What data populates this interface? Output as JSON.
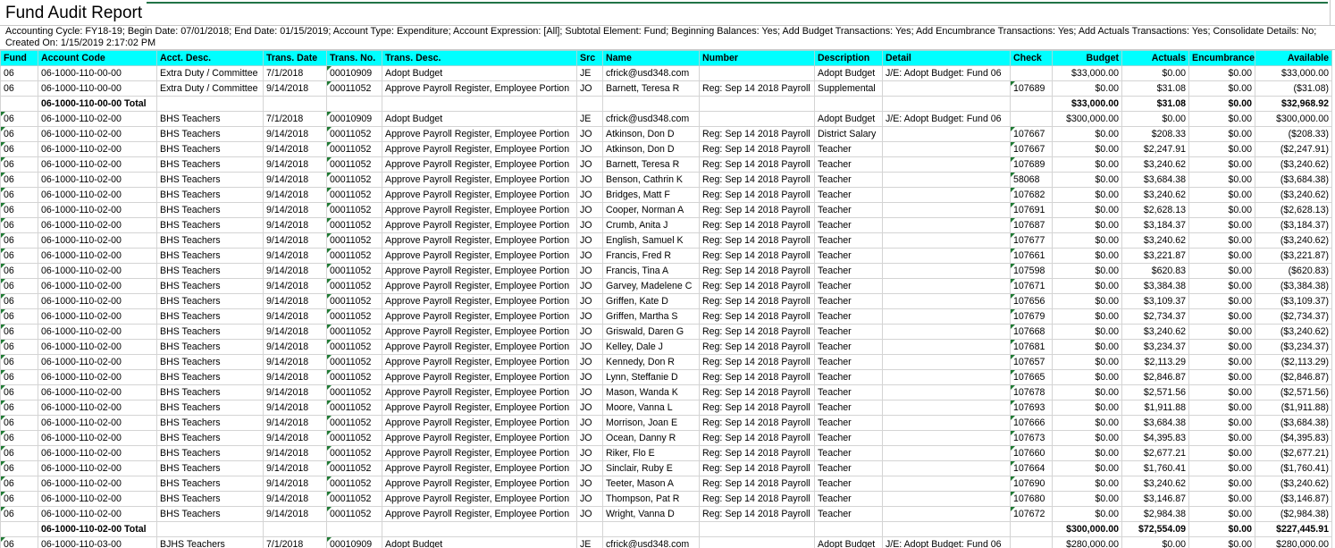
{
  "report": {
    "title": "Fund Audit Report",
    "params_line1": "Accounting Cycle: FY18-19; Begin Date: 07/01/2018; End Date: 01/15/2019; Account Type: Expenditure; Account Expression: [All]; Subtotal Element: Fund; Beginning Balances: Yes; Add Budget Transactions: Yes; Add Encumbrance Transactions: Yes; Add Actuals Transactions: Yes; Consolidate Details: No;",
    "params_line2": "Created On: 1/15/2019 2:17:02 PM"
  },
  "columns": [
    {
      "label": "Fund",
      "align": "left"
    },
    {
      "label": "Account Code",
      "align": "left"
    },
    {
      "label": "Acct. Desc.",
      "align": "left"
    },
    {
      "label": "Trans. Date",
      "align": "left"
    },
    {
      "label": "Trans. No.",
      "align": "left"
    },
    {
      "label": "Trans. Desc.",
      "align": "left"
    },
    {
      "label": "Src",
      "align": "left"
    },
    {
      "label": "Name",
      "align": "left"
    },
    {
      "label": "Number",
      "align": "left"
    },
    {
      "label": "Description",
      "align": "left"
    },
    {
      "label": "Detail",
      "align": "left"
    },
    {
      "label": "Check",
      "align": "left"
    },
    {
      "label": "Budget",
      "align": "right"
    },
    {
      "label": "Actuals",
      "align": "right"
    },
    {
      "label": "Encumbrance",
      "align": "right"
    },
    {
      "label": "Available",
      "align": "right"
    }
  ],
  "rows": [
    {
      "type": "data",
      "fund_flag": false,
      "no_flag": true,
      "check_flag": false,
      "cells": [
        "06",
        "06-1000-110-00-00",
        "Extra Duty / Committee",
        "7/1/2018",
        "00010909",
        "Adopt Budget",
        "JE",
        "cfrick@usd348.com",
        "",
        "Adopt Budget",
        "J/E: Adopt Budget: Fund 06",
        "",
        "$33,000.00",
        "$0.00",
        "$0.00",
        "$33,000.00"
      ]
    },
    {
      "type": "data",
      "fund_flag": false,
      "no_flag": true,
      "check_flag": true,
      "cells": [
        "06",
        "06-1000-110-00-00",
        "Extra Duty / Committee",
        "9/14/2018",
        "00011052",
        "Approve Payroll Register, Employee Portion",
        "JO",
        "Barnett, Teresa R",
        "Reg: Sep 14 2018 Payroll",
        "Supplemental",
        "",
        "107689",
        "$0.00",
        "$31.08",
        "$0.00",
        "($31.08)"
      ]
    },
    {
      "type": "total",
      "cells": [
        "",
        "06-1000-110-00-00 Total",
        "",
        "",
        "",
        "",
        "",
        "",
        "",
        "",
        "",
        "",
        "$33,000.00",
        "$31.08",
        "$0.00",
        "$32,968.92"
      ]
    },
    {
      "type": "data",
      "fund_flag": true,
      "no_flag": true,
      "check_flag": false,
      "cells": [
        "06",
        "06-1000-110-02-00",
        "BHS Teachers",
        "7/1/2018",
        "00010909",
        "Adopt Budget",
        "JE",
        "cfrick@usd348.com",
        "",
        "Adopt Budget",
        "J/E: Adopt Budget: Fund 06",
        "",
        "$300,000.00",
        "$0.00",
        "$0.00",
        "$300,000.00"
      ]
    },
    {
      "type": "data",
      "fund_flag": true,
      "no_flag": true,
      "check_flag": true,
      "cells": [
        "06",
        "06-1000-110-02-00",
        "BHS Teachers",
        "9/14/2018",
        "00011052",
        "Approve Payroll Register, Employee Portion",
        "JO",
        "Atkinson, Don D",
        "Reg: Sep 14 2018 Payroll",
        "District Salary",
        "",
        "107667",
        "$0.00",
        "$208.33",
        "$0.00",
        "($208.33)"
      ]
    },
    {
      "type": "data",
      "fund_flag": true,
      "no_flag": true,
      "check_flag": true,
      "cells": [
        "06",
        "06-1000-110-02-00",
        "BHS Teachers",
        "9/14/2018",
        "00011052",
        "Approve Payroll Register, Employee Portion",
        "JO",
        "Atkinson, Don D",
        "Reg: Sep 14 2018 Payroll",
        "Teacher",
        "",
        "107667",
        "$0.00",
        "$2,247.91",
        "$0.00",
        "($2,247.91)"
      ]
    },
    {
      "type": "data",
      "fund_flag": true,
      "no_flag": true,
      "check_flag": true,
      "cells": [
        "06",
        "06-1000-110-02-00",
        "BHS Teachers",
        "9/14/2018",
        "00011052",
        "Approve Payroll Register, Employee Portion",
        "JO",
        "Barnett, Teresa R",
        "Reg: Sep 14 2018 Payroll",
        "Teacher",
        "",
        "107689",
        "$0.00",
        "$3,240.62",
        "$0.00",
        "($3,240.62)"
      ]
    },
    {
      "type": "data",
      "fund_flag": true,
      "no_flag": true,
      "check_flag": true,
      "cells": [
        "06",
        "06-1000-110-02-00",
        "BHS Teachers",
        "9/14/2018",
        "00011052",
        "Approve Payroll Register, Employee Portion",
        "JO",
        "Benson, Cathrin K",
        "Reg: Sep 14 2018 Payroll",
        "Teacher",
        "",
        "58068",
        "$0.00",
        "$3,684.38",
        "$0.00",
        "($3,684.38)"
      ]
    },
    {
      "type": "data",
      "fund_flag": true,
      "no_flag": true,
      "check_flag": true,
      "cells": [
        "06",
        "06-1000-110-02-00",
        "BHS Teachers",
        "9/14/2018",
        "00011052",
        "Approve Payroll Register, Employee Portion",
        "JO",
        "Bridges, Matt F",
        "Reg: Sep 14 2018 Payroll",
        "Teacher",
        "",
        "107682",
        "$0.00",
        "$3,240.62",
        "$0.00",
        "($3,240.62)"
      ]
    },
    {
      "type": "data",
      "fund_flag": true,
      "no_flag": true,
      "check_flag": true,
      "cells": [
        "06",
        "06-1000-110-02-00",
        "BHS Teachers",
        "9/14/2018",
        "00011052",
        "Approve Payroll Register, Employee Portion",
        "JO",
        "Cooper, Norman A",
        "Reg: Sep 14 2018 Payroll",
        "Teacher",
        "",
        "107691",
        "$0.00",
        "$2,628.13",
        "$0.00",
        "($2,628.13)"
      ]
    },
    {
      "type": "data",
      "fund_flag": true,
      "no_flag": true,
      "check_flag": true,
      "cells": [
        "06",
        "06-1000-110-02-00",
        "BHS Teachers",
        "9/14/2018",
        "00011052",
        "Approve Payroll Register, Employee Portion",
        "JO",
        "Crumb, Anita J",
        "Reg: Sep 14 2018 Payroll",
        "Teacher",
        "",
        "107687",
        "$0.00",
        "$3,184.37",
        "$0.00",
        "($3,184.37)"
      ]
    },
    {
      "type": "data",
      "fund_flag": true,
      "no_flag": true,
      "check_flag": true,
      "cells": [
        "06",
        "06-1000-110-02-00",
        "BHS Teachers",
        "9/14/2018",
        "00011052",
        "Approve Payroll Register, Employee Portion",
        "JO",
        "English, Samuel K",
        "Reg: Sep 14 2018 Payroll",
        "Teacher",
        "",
        "107677",
        "$0.00",
        "$3,240.62",
        "$0.00",
        "($3,240.62)"
      ]
    },
    {
      "type": "data",
      "fund_flag": true,
      "no_flag": true,
      "check_flag": true,
      "cells": [
        "06",
        "06-1000-110-02-00",
        "BHS Teachers",
        "9/14/2018",
        "00011052",
        "Approve Payroll Register, Employee Portion",
        "JO",
        "Francis, Fred R",
        "Reg: Sep 14 2018 Payroll",
        "Teacher",
        "",
        "107661",
        "$0.00",
        "$3,221.87",
        "$0.00",
        "($3,221.87)"
      ]
    },
    {
      "type": "data",
      "fund_flag": true,
      "no_flag": true,
      "check_flag": true,
      "cells": [
        "06",
        "06-1000-110-02-00",
        "BHS Teachers",
        "9/14/2018",
        "00011052",
        "Approve Payroll Register, Employee Portion",
        "JO",
        "Francis, Tina A",
        "Reg: Sep 14 2018 Payroll",
        "Teacher",
        "",
        "107598",
        "$0.00",
        "$620.83",
        "$0.00",
        "($620.83)"
      ]
    },
    {
      "type": "data",
      "fund_flag": true,
      "no_flag": true,
      "check_flag": true,
      "cells": [
        "06",
        "06-1000-110-02-00",
        "BHS Teachers",
        "9/14/2018",
        "00011052",
        "Approve Payroll Register, Employee Portion",
        "JO",
        "Garvey, Madelene C",
        "Reg: Sep 14 2018 Payroll",
        "Teacher",
        "",
        "107671",
        "$0.00",
        "$3,384.38",
        "$0.00",
        "($3,384.38)"
      ]
    },
    {
      "type": "data",
      "fund_flag": true,
      "no_flag": true,
      "check_flag": true,
      "cells": [
        "06",
        "06-1000-110-02-00",
        "BHS Teachers",
        "9/14/2018",
        "00011052",
        "Approve Payroll Register, Employee Portion",
        "JO",
        "Griffen, Kate D",
        "Reg: Sep 14 2018 Payroll",
        "Teacher",
        "",
        "107656",
        "$0.00",
        "$3,109.37",
        "$0.00",
        "($3,109.37)"
      ]
    },
    {
      "type": "data",
      "fund_flag": true,
      "no_flag": true,
      "check_flag": true,
      "cells": [
        "06",
        "06-1000-110-02-00",
        "BHS Teachers",
        "9/14/2018",
        "00011052",
        "Approve Payroll Register, Employee Portion",
        "JO",
        "Griffen, Martha S",
        "Reg: Sep 14 2018 Payroll",
        "Teacher",
        "",
        "107679",
        "$0.00",
        "$2,734.37",
        "$0.00",
        "($2,734.37)"
      ]
    },
    {
      "type": "data",
      "fund_flag": true,
      "no_flag": true,
      "check_flag": true,
      "cells": [
        "06",
        "06-1000-110-02-00",
        "BHS Teachers",
        "9/14/2018",
        "00011052",
        "Approve Payroll Register, Employee Portion",
        "JO",
        "Griswald, Daren G",
        "Reg: Sep 14 2018 Payroll",
        "Teacher",
        "",
        "107668",
        "$0.00",
        "$3,240.62",
        "$0.00",
        "($3,240.62)"
      ]
    },
    {
      "type": "data",
      "fund_flag": true,
      "no_flag": true,
      "check_flag": true,
      "cells": [
        "06",
        "06-1000-110-02-00",
        "BHS Teachers",
        "9/14/2018",
        "00011052",
        "Approve Payroll Register, Employee Portion",
        "JO",
        "Kelley, Dale J",
        "Reg: Sep 14 2018 Payroll",
        "Teacher",
        "",
        "107681",
        "$0.00",
        "$3,234.37",
        "$0.00",
        "($3,234.37)"
      ]
    },
    {
      "type": "data",
      "fund_flag": true,
      "no_flag": true,
      "check_flag": true,
      "cells": [
        "06",
        "06-1000-110-02-00",
        "BHS Teachers",
        "9/14/2018",
        "00011052",
        "Approve Payroll Register, Employee Portion",
        "JO",
        "Kennedy, Don R",
        "Reg: Sep 14 2018 Payroll",
        "Teacher",
        "",
        "107657",
        "$0.00",
        "$2,113.29",
        "$0.00",
        "($2,113.29)"
      ]
    },
    {
      "type": "data",
      "fund_flag": true,
      "no_flag": true,
      "check_flag": true,
      "cells": [
        "06",
        "06-1000-110-02-00",
        "BHS Teachers",
        "9/14/2018",
        "00011052",
        "Approve Payroll Register, Employee Portion",
        "JO",
        "Lynn, Steffanie D",
        "Reg: Sep 14 2018 Payroll",
        "Teacher",
        "",
        "107665",
        "$0.00",
        "$2,846.87",
        "$0.00",
        "($2,846.87)"
      ]
    },
    {
      "type": "data",
      "fund_flag": true,
      "no_flag": true,
      "check_flag": true,
      "cells": [
        "06",
        "06-1000-110-02-00",
        "BHS Teachers",
        "9/14/2018",
        "00011052",
        "Approve Payroll Register, Employee Portion",
        "JO",
        "Mason, Wanda K",
        "Reg: Sep 14 2018 Payroll",
        "Teacher",
        "",
        "107678",
        "$0.00",
        "$2,571.56",
        "$0.00",
        "($2,571.56)"
      ]
    },
    {
      "type": "data",
      "fund_flag": true,
      "no_flag": true,
      "check_flag": true,
      "cells": [
        "06",
        "06-1000-110-02-00",
        "BHS Teachers",
        "9/14/2018",
        "00011052",
        "Approve Payroll Register, Employee Portion",
        "JO",
        "Moore, Vanna L",
        "Reg: Sep 14 2018 Payroll",
        "Teacher",
        "",
        "107693",
        "$0.00",
        "$1,911.88",
        "$0.00",
        "($1,911.88)"
      ]
    },
    {
      "type": "data",
      "fund_flag": true,
      "no_flag": true,
      "check_flag": true,
      "cells": [
        "06",
        "06-1000-110-02-00",
        "BHS Teachers",
        "9/14/2018",
        "00011052",
        "Approve Payroll Register, Employee Portion",
        "JO",
        "Morrison, Joan E",
        "Reg: Sep 14 2018 Payroll",
        "Teacher",
        "",
        "107666",
        "$0.00",
        "$3,684.38",
        "$0.00",
        "($3,684.38)"
      ]
    },
    {
      "type": "data",
      "fund_flag": true,
      "no_flag": true,
      "check_flag": true,
      "cells": [
        "06",
        "06-1000-110-02-00",
        "BHS Teachers",
        "9/14/2018",
        "00011052",
        "Approve Payroll Register, Employee Portion",
        "JO",
        "Ocean, Danny R",
        "Reg: Sep 14 2018 Payroll",
        "Teacher",
        "",
        "107673",
        "$0.00",
        "$4,395.83",
        "$0.00",
        "($4,395.83)"
      ]
    },
    {
      "type": "data",
      "fund_flag": true,
      "no_flag": true,
      "check_flag": true,
      "cells": [
        "06",
        "06-1000-110-02-00",
        "BHS Teachers",
        "9/14/2018",
        "00011052",
        "Approve Payroll Register, Employee Portion",
        "JO",
        "Riker, Flo E",
        "Reg: Sep 14 2018 Payroll",
        "Teacher",
        "",
        "107660",
        "$0.00",
        "$2,677.21",
        "$0.00",
        "($2,677.21)"
      ]
    },
    {
      "type": "data",
      "fund_flag": true,
      "no_flag": true,
      "check_flag": true,
      "cells": [
        "06",
        "06-1000-110-02-00",
        "BHS Teachers",
        "9/14/2018",
        "00011052",
        "Approve Payroll Register, Employee Portion",
        "JO",
        "Sinclair, Ruby E",
        "Reg: Sep 14 2018 Payroll",
        "Teacher",
        "",
        "107664",
        "$0.00",
        "$1,760.41",
        "$0.00",
        "($1,760.41)"
      ]
    },
    {
      "type": "data",
      "fund_flag": true,
      "no_flag": true,
      "check_flag": true,
      "cells": [
        "06",
        "06-1000-110-02-00",
        "BHS Teachers",
        "9/14/2018",
        "00011052",
        "Approve Payroll Register, Employee Portion",
        "JO",
        "Teeter, Mason A",
        "Reg: Sep 14 2018 Payroll",
        "Teacher",
        "",
        "107690",
        "$0.00",
        "$3,240.62",
        "$0.00",
        "($3,240.62)"
      ]
    },
    {
      "type": "data",
      "fund_flag": true,
      "no_flag": true,
      "check_flag": true,
      "cells": [
        "06",
        "06-1000-110-02-00",
        "BHS Teachers",
        "9/14/2018",
        "00011052",
        "Approve Payroll Register, Employee Portion",
        "JO",
        "Thompson, Pat R",
        "Reg: Sep 14 2018 Payroll",
        "Teacher",
        "",
        "107680",
        "$0.00",
        "$3,146.87",
        "$0.00",
        "($3,146.87)"
      ]
    },
    {
      "type": "data",
      "fund_flag": true,
      "no_flag": true,
      "check_flag": true,
      "cells": [
        "06",
        "06-1000-110-02-00",
        "BHS Teachers",
        "9/14/2018",
        "00011052",
        "Approve Payroll Register, Employee Portion",
        "JO",
        "Wright, Vanna D",
        "Reg: Sep 14 2018 Payroll",
        "Teacher",
        "",
        "107672",
        "$0.00",
        "$2,984.38",
        "$0.00",
        "($2,984.38)"
      ]
    },
    {
      "type": "total",
      "cells": [
        "",
        "06-1000-110-02-00 Total",
        "",
        "",
        "",
        "",
        "",
        "",
        "",
        "",
        "",
        "",
        "$300,000.00",
        "$72,554.09",
        "$0.00",
        "$227,445.91"
      ]
    },
    {
      "type": "data",
      "fund_flag": true,
      "no_flag": true,
      "check_flag": false,
      "cells": [
        "06",
        "06-1000-110-03-00",
        "BJHS Teachers",
        "7/1/2018",
        "00010909",
        "Adopt Budget",
        "JE",
        "cfrick@usd348.com",
        "",
        "Adopt Budget",
        "J/E: Adopt Budget: Fund 06",
        "",
        "$280,000.00",
        "$0.00",
        "$0.00",
        "$280,000.00"
      ]
    }
  ]
}
